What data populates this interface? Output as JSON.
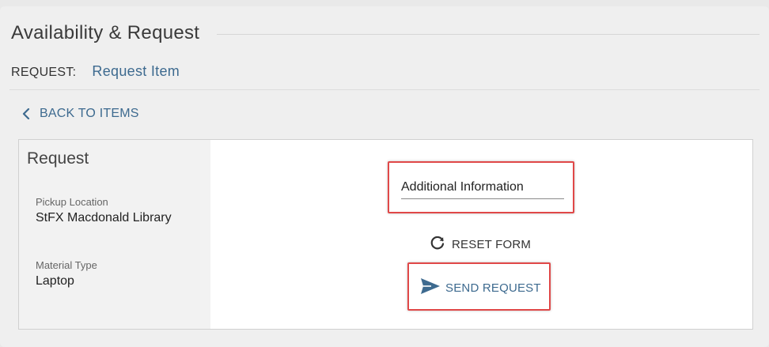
{
  "header": {
    "title": "Availability & Request"
  },
  "request_row": {
    "label": "REQUEST:",
    "value": "Request Item"
  },
  "back_link": {
    "label": "BACK TO ITEMS",
    "icon": "chevron-left-icon"
  },
  "card": {
    "heading": "Request",
    "fields": [
      {
        "label": "Pickup Location",
        "value": "StFX Macdonald Library"
      },
      {
        "label": "Material Type",
        "value": "Laptop"
      }
    ]
  },
  "form": {
    "additional_info_placeholder": "Additional Information",
    "additional_info_value": "",
    "reset_label": "RESET FORM",
    "reset_icon": "refresh-icon",
    "send_label": "SEND REQUEST",
    "send_icon": "paper-plane-icon"
  },
  "colors": {
    "accent": "#3d6a8f",
    "highlight_border": "#e04848",
    "panel_bg": "#f2f2f2"
  }
}
